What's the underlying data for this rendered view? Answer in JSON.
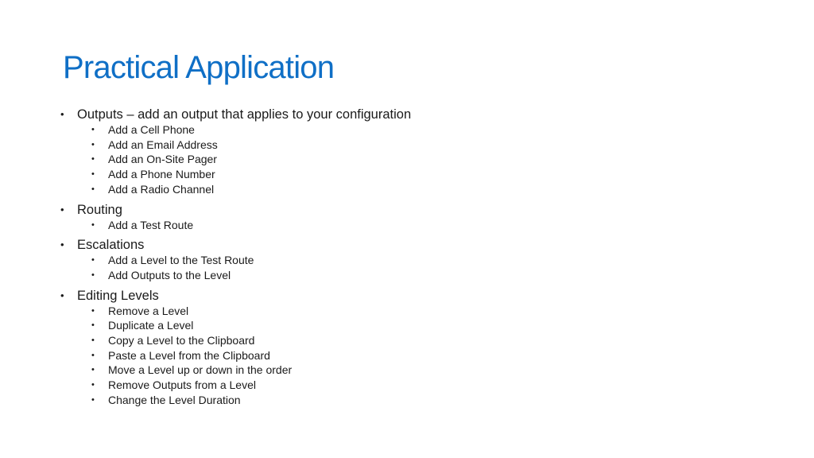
{
  "slide": {
    "title": "Practical Application",
    "title_color": "#0f6fc6",
    "bullet_glyph": "•",
    "sections": [
      {
        "label": "Outputs – add an output that applies to your configuration",
        "items": [
          "Add a Cell Phone",
          "Add an Email Address",
          "Add an On-Site Pager",
          "Add a Phone Number",
          "Add a Radio Channel"
        ]
      },
      {
        "label": "Routing",
        "items": [
          "Add a Test Route"
        ]
      },
      {
        "label": "Escalations",
        "items": [
          "Add a Level to the Test Route",
          "Add Outputs to the Level"
        ]
      },
      {
        "label": "Editing Levels",
        "items": [
          "Remove a Level",
          "Duplicate a Level",
          "Copy a Level to the Clipboard",
          "Paste a Level from the Clipboard",
          "Move a Level up or down in the order",
          "Remove Outputs from a Level",
          "Change the Level Duration"
        ]
      }
    ]
  }
}
